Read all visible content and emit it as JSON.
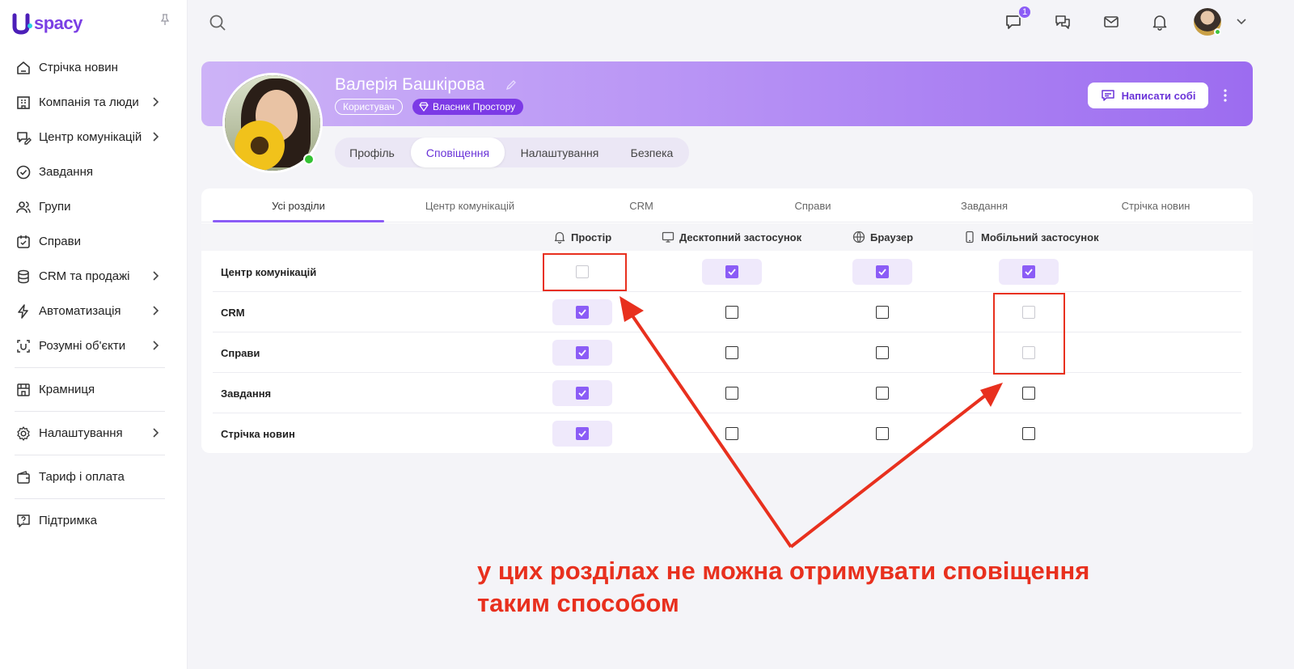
{
  "app": {
    "logo_text": "spacy",
    "logo_letter": "U"
  },
  "sidebar": {
    "items": [
      {
        "label": "Стрічка новин",
        "icon": "home-icon",
        "chevron": false
      },
      {
        "label": "Компанія та люди",
        "icon": "building-icon",
        "chevron": true
      },
      {
        "label": "Центр комунікацій",
        "icon": "chat-edit-icon",
        "chevron": true
      },
      {
        "label": "Завдання",
        "icon": "check-circle-icon",
        "chevron": false
      },
      {
        "label": "Групи",
        "icon": "users-icon",
        "chevron": false
      },
      {
        "label": "Справи",
        "icon": "calendar-check-icon",
        "chevron": false
      },
      {
        "label": "CRM та продажі",
        "icon": "database-icon",
        "chevron": true
      },
      {
        "label": "Автоматизація",
        "icon": "bolt-icon",
        "chevron": true
      },
      {
        "label": "Розумні об'єкти",
        "icon": "smart-object-icon",
        "chevron": true
      },
      {
        "label": "Крамниця",
        "icon": "store-icon",
        "chevron": false
      },
      {
        "label": "Налаштування",
        "icon": "gear-icon",
        "chevron": true
      },
      {
        "label": "Тариф і оплата",
        "icon": "wallet-icon",
        "chevron": false
      },
      {
        "label": "Підтримка",
        "icon": "help-icon",
        "chevron": false
      }
    ]
  },
  "topbar": {
    "messages_badge": "1"
  },
  "profile": {
    "name": "Валерія Башкірова",
    "role": "Користувач",
    "owner": "Власник Простору",
    "write_self": "Написати собі",
    "tabs": [
      "Профіль",
      "Сповіщення",
      "Налаштування",
      "Безпека"
    ],
    "active_tab": "Сповіщення"
  },
  "notifications": {
    "section_tabs": [
      "Усі розділи",
      "Центр комунікацій",
      "CRM",
      "Справи",
      "Завдання",
      "Стрічка новин"
    ],
    "active_section": "Усі розділи",
    "columns": [
      {
        "label": "Простір",
        "icon": "bell-icon"
      },
      {
        "label": "Десктопний застосунок",
        "icon": "monitor-icon"
      },
      {
        "label": "Браузер",
        "icon": "globe-icon"
      },
      {
        "label": "Мобільний застосунок",
        "icon": "smartphone-icon"
      }
    ],
    "rows": [
      {
        "label": "Центр комунікацій",
        "values": [
          "disabled",
          "checked",
          "checked",
          "checked"
        ]
      },
      {
        "label": "CRM",
        "values": [
          "checked",
          "unchecked",
          "unchecked",
          "disabled"
        ]
      },
      {
        "label": "Справи",
        "values": [
          "checked",
          "unchecked",
          "unchecked",
          "disabled"
        ]
      },
      {
        "label": "Завдання",
        "values": [
          "checked",
          "unchecked",
          "unchecked",
          "unchecked"
        ]
      },
      {
        "label": "Стрічка новин",
        "values": [
          "checked",
          "unchecked",
          "unchecked",
          "unchecked"
        ]
      }
    ]
  },
  "annotation": {
    "line1": "у цих розділах не можна отримувати сповіщення",
    "line2": "таким способом",
    "color": "#e8301e"
  },
  "colors": {
    "accent": "#8b5cf6",
    "accent_dark": "#6a33d8"
  }
}
